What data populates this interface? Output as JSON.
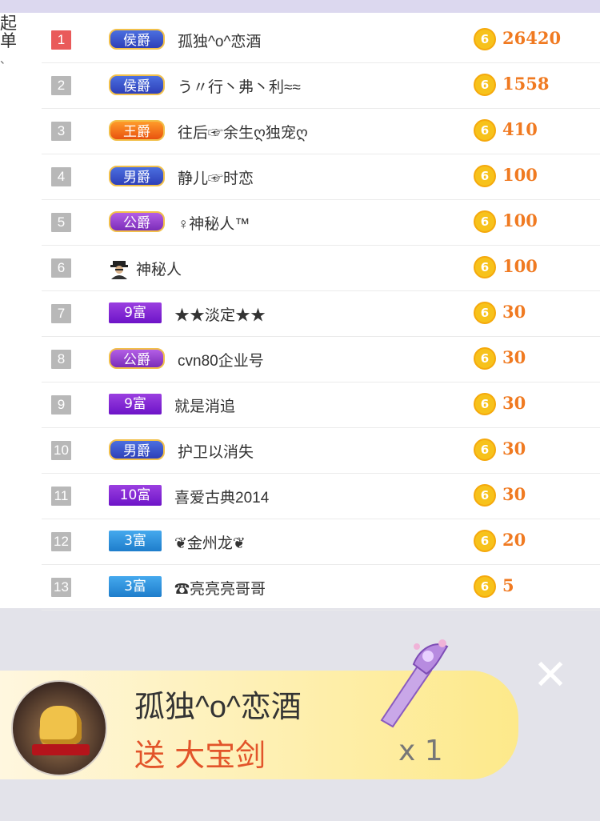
{
  "side_text": {
    "line1": "起",
    "line2": "单"
  },
  "ranking": [
    {
      "rank": "1",
      "badge": "侯爵",
      "badge_style": "jue-blue",
      "name": "孤独^o^恋酒",
      "amount": "26420"
    },
    {
      "rank": "2",
      "badge": "侯爵",
      "badge_style": "jue-blue",
      "name": "う〃行丶弗丶利≈≈",
      "amount": "1558"
    },
    {
      "rank": "3",
      "badge": "王爵",
      "badge_style": "jue-wang",
      "name": "往后☞余生ღ独宠ღ",
      "amount": "410"
    },
    {
      "rank": "4",
      "badge": "男爵",
      "badge_style": "jue-blue",
      "name": "静儿☞时恋",
      "amount": "100"
    },
    {
      "rank": "5",
      "badge": "公爵",
      "badge_style": "jue-gong",
      "name": "♀神秘人™",
      "amount": "100"
    },
    {
      "rank": "6",
      "badge": "",
      "badge_style": "mystery",
      "name": "神秘人",
      "amount": "100"
    },
    {
      "rank": "7",
      "badge": "9富",
      "badge_style": "fu-purple",
      "name": "★★淡定★★",
      "amount": "30"
    },
    {
      "rank": "8",
      "badge": "公爵",
      "badge_style": "jue-gong",
      "name": "cvn80企业号",
      "amount": "30"
    },
    {
      "rank": "9",
      "badge": "9富",
      "badge_style": "fu-purple",
      "name": "就是消追",
      "amount": "30"
    },
    {
      "rank": "10",
      "badge": "男爵",
      "badge_style": "jue-blue",
      "name": "护卫以消失",
      "amount": "30"
    },
    {
      "rank": "11",
      "badge": "10富",
      "badge_style": "fu-purple",
      "name": "喜爱古典2014",
      "amount": "30"
    },
    {
      "rank": "12",
      "badge": "3富",
      "badge_style": "fu-blue",
      "name": "❦金州龙❦",
      "amount": "20"
    },
    {
      "rank": "13",
      "badge": "3富",
      "badge_style": "fu-blue",
      "name": "☎亮亮亮哥哥",
      "amount": "5"
    }
  ],
  "coin_glyph": "6",
  "gift": {
    "sender": "孤独^o^恋酒",
    "action": "送 大宝剑",
    "count": "x 1",
    "close_glyph": "✕"
  },
  "colors": {
    "amount": "#f07a21",
    "coin": "#f7c21b",
    "rank_first": "#e95a5a",
    "rank_default": "#b8b8b8"
  },
  "icons": [
    "coin-icon",
    "mystery-person-icon",
    "sword-gift-icon",
    "close-icon",
    "sender-avatar"
  ]
}
